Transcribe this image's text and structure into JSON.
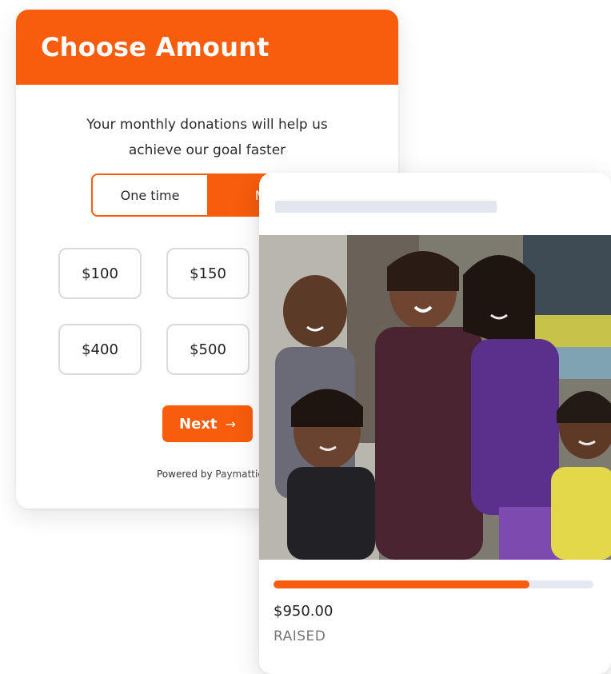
{
  "donation_form": {
    "title": "Choose Amount",
    "subtitle_line1": "Your monthly donations will help us",
    "subtitle_line2": "achieve our goal faster",
    "frequency": {
      "options": [
        "One time",
        "Mo"
      ],
      "selected": "Mo"
    },
    "amounts": [
      "$100",
      "$150",
      "$400",
      "$500"
    ],
    "next_label": "Next",
    "next_icon": "arrow-right-icon",
    "powered_by_prefix": "Powered by",
    "powered_by_brand": "Paymattic"
  },
  "campaign": {
    "photo_icon": "campaign-photo",
    "progress_fraction": 0.8,
    "raised_amount": "$950.00",
    "raised_label": "RAISED"
  },
  "colors": {
    "accent": "#f85c0d",
    "track": "#e6e8ef",
    "border": "#d9dbe0"
  }
}
